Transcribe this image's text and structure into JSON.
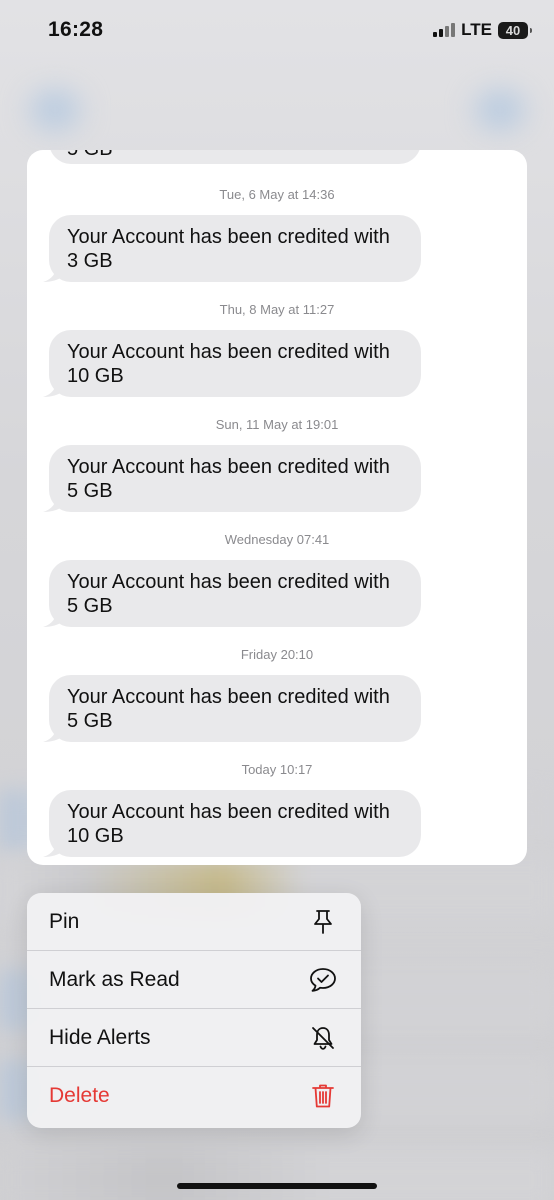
{
  "status_bar": {
    "time": "16:28",
    "network": "LTE",
    "battery": "40"
  },
  "conversation": {
    "partial_top_text": "5 GB",
    "messages": [
      {
        "timestamp": "Tue, 6 May at 14:36",
        "text": "Your Account has been credited with 3 GB"
      },
      {
        "timestamp": "Thu, 8 May at 11:27",
        "text": "Your Account has been credited with 10 GB"
      },
      {
        "timestamp": "Sun, 11 May at 19:01",
        "text": "Your Account has been credited with 5 GB"
      },
      {
        "timestamp": "Wednesday 07:41",
        "text": "Your Account has been credited with 5 GB"
      },
      {
        "timestamp": "Friday 20:10",
        "text": "Your Account has been credited with 5 GB"
      },
      {
        "timestamp": "Today 10:17",
        "text": "Your Account has been credited with 10 GB"
      }
    ]
  },
  "context_menu": {
    "items": [
      {
        "label": "Pin",
        "icon": "pin-icon"
      },
      {
        "label": "Mark as Read",
        "icon": "message-check-icon"
      },
      {
        "label": "Hide Alerts",
        "icon": "bell-slash-icon"
      },
      {
        "label": "Delete",
        "icon": "trash-icon"
      }
    ]
  },
  "colors": {
    "bubble": "#e9e9eb",
    "destructive": "#e53935",
    "timestamp": "#8a8a8e"
  }
}
